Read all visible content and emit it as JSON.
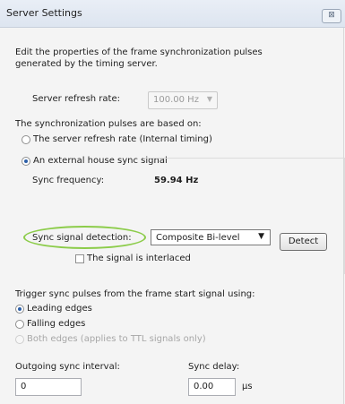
{
  "window": {
    "title": "Server Settings",
    "close_label": "⊠"
  },
  "description": "Edit the properties of the frame synchronization pulses generated by the timing server.",
  "refresh_rate": {
    "label": "Server refresh rate:",
    "value": "100.00 Hz",
    "arrow": "▼"
  },
  "sync_basis": {
    "label": "The synchronization pulses are based on:",
    "options": [
      {
        "label": "The server refresh rate (Internal timing)",
        "selected": false
      },
      {
        "label": "An external house sync signal",
        "selected": true
      }
    ]
  },
  "external": {
    "sync_frequency_label": "Sync frequency:",
    "sync_frequency_value": "59.94 Hz",
    "detection_label": "Sync signal detection:",
    "detection_value": "Composite Bi-level",
    "detection_arrow": "▼",
    "detect_button": "Detect",
    "interlaced_label": "The signal is interlaced",
    "interlaced_checked": false
  },
  "trigger": {
    "label": "Trigger sync pulses from the frame start signal using:",
    "options": [
      {
        "label": "Leading edges",
        "selected": true,
        "enabled": true
      },
      {
        "label": "Falling edges",
        "selected": false,
        "enabled": true
      },
      {
        "label": "Both edges (applies to TTL signals only)",
        "selected": false,
        "enabled": false
      }
    ]
  },
  "outgoing": {
    "interval_label": "Outgoing sync interval:",
    "interval_value": "0",
    "delay_label": "Sync delay:",
    "delay_value": "0.00",
    "delay_unit": "µs"
  },
  "colors": {
    "highlight": "#8ccc4a",
    "radio_selected": "#2c5fa8"
  }
}
